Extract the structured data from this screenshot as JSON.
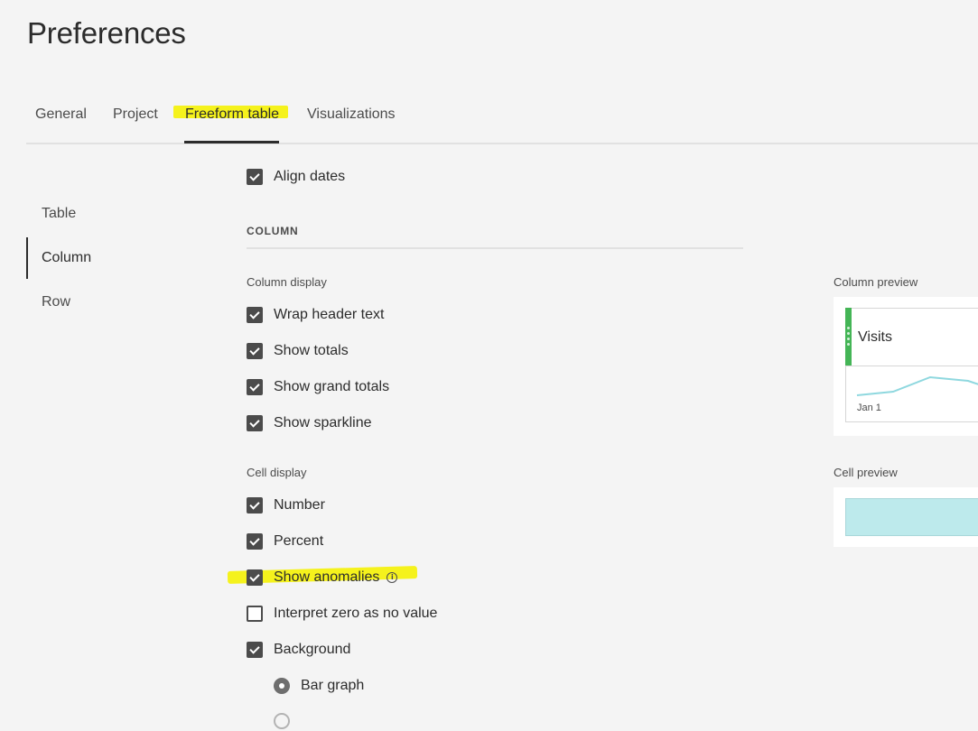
{
  "page": {
    "title": "Preferences"
  },
  "tabs": [
    {
      "label": "General",
      "active": false
    },
    {
      "label": "Project",
      "active": false
    },
    {
      "label": "Freeform table",
      "active": true
    },
    {
      "label": "Visualizations",
      "active": false
    }
  ],
  "sidenav": [
    {
      "label": "Table",
      "active": false
    },
    {
      "label": "Column",
      "active": true
    },
    {
      "label": "Row",
      "active": false
    }
  ],
  "options": {
    "align_dates": {
      "label": "Align dates",
      "checked": true
    },
    "section_header": "COLUMN",
    "column_display": {
      "heading": "Column display",
      "items": [
        {
          "label": "Wrap header text",
          "checked": true
        },
        {
          "label": "Show totals",
          "checked": true
        },
        {
          "label": "Show grand totals",
          "checked": true
        },
        {
          "label": "Show sparkline",
          "checked": true
        }
      ]
    },
    "cell_display": {
      "heading": "Cell display",
      "items": [
        {
          "label": "Number",
          "checked": true
        },
        {
          "label": "Percent",
          "checked": true
        },
        {
          "label": "Show anomalies",
          "checked": true,
          "has_info_icon": true
        },
        {
          "label": "Interpret zero as no value",
          "checked": false
        },
        {
          "label": "Background",
          "checked": true
        }
      ],
      "background_options": [
        {
          "label": "Bar graph",
          "selected": true
        }
      ]
    }
  },
  "preview": {
    "column_label": "Column preview",
    "column_title": "Visits",
    "sparkline_date": "Jan 1",
    "cell_label": "Cell preview"
  },
  "colors": {
    "highlight": "#f5f21c",
    "drag_handle": "#44b556",
    "sparkline": "#8fd8df",
    "cell_fill": "#bdeaec"
  },
  "icons": {
    "info": "info-icon",
    "drag": "drag-handle-icon",
    "check": "checkmark-icon"
  }
}
